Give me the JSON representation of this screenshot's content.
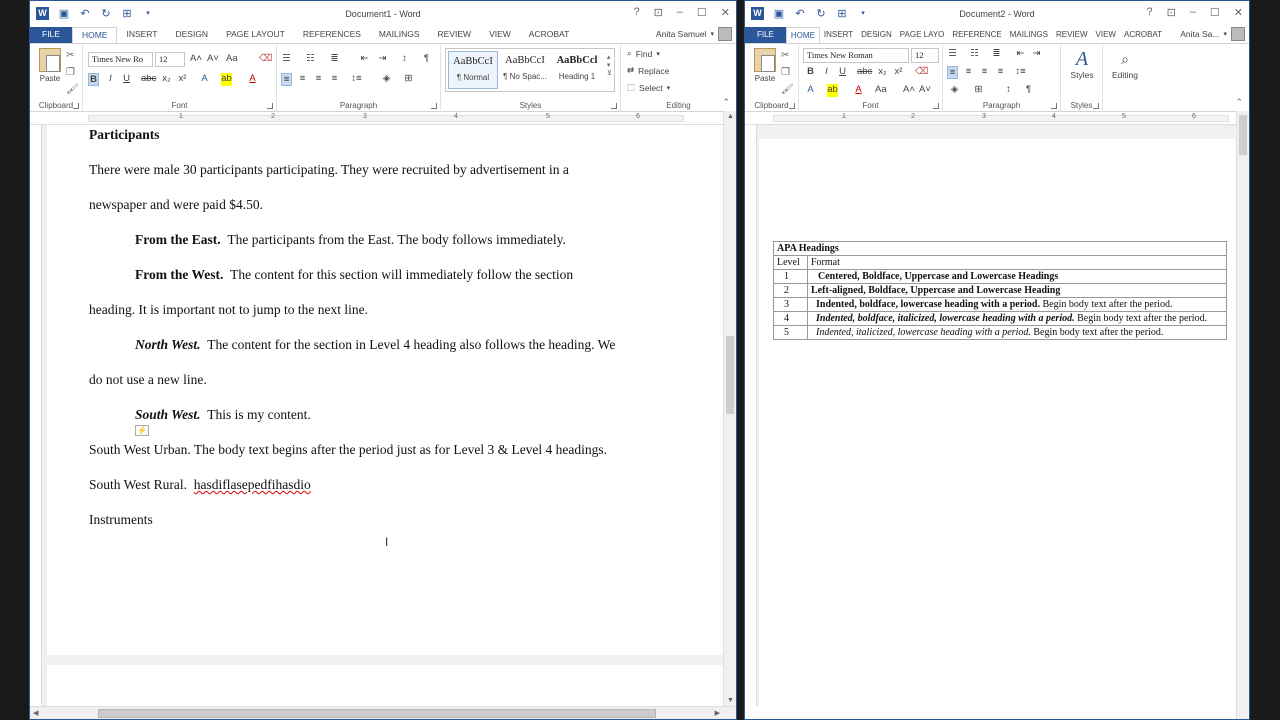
{
  "doc1": {
    "window_title": "Document1 - Word",
    "tabs": [
      "FILE",
      "HOME",
      "INSERT",
      "DESIGN",
      "PAGE LAYOUT",
      "REFERENCES",
      "MAILINGS",
      "REVIEW",
      "VIEW",
      "ACROBAT"
    ],
    "user": "Anita Samuel",
    "clipboard": {
      "paste": "Paste",
      "label": "Clipboard"
    },
    "font": {
      "name": "Times New Ro",
      "size": "12",
      "label": "Font",
      "aa": "Aa"
    },
    "paragraph": {
      "label": "Paragraph"
    },
    "styles": {
      "label": "Styles",
      "items": [
        {
          "preview": "AaBbCcI",
          "name": "¶ Normal"
        },
        {
          "preview": "AaBbCcI",
          "name": "¶ No Spac..."
        },
        {
          "preview": "AaBbCcl",
          "name": "Heading 1"
        }
      ]
    },
    "editing": {
      "label": "Editing",
      "find": "Find",
      "replace": "Replace",
      "select": "Select"
    },
    "ruler_numbers": [
      "1",
      "2",
      "3",
      "4",
      "5",
      "6"
    ],
    "content": {
      "participants_heading": "Participants",
      "p1_line1": "There were male 30 participants participating. They were recruited by advertisement in a",
      "p1_line2": "newspaper and were paid $4.50.",
      "east_heading": "From the East.",
      "east_body": "The participants from the East. The body follows immediately.",
      "west_heading": "From the West.",
      "west_body1": "The content for this section will immediately follow the section",
      "west_body2": "heading.  It is important not to jump to the next line.",
      "nw_heading": "North West.",
      "nw_body1": "The content for the section in Level 4 heading also follows the heading. We",
      "nw_body2": "do not use a new line.",
      "sw_heading": "South West.",
      "sw_body": "This is my content.",
      "swu_line": "South West Urban.  The body text begins after the period just as for Level 3 & Level 4 headings.",
      "swr_head": "South West Rural.",
      "swr_body": "hasdiflasepedfihasdio",
      "instruments": "Instruments"
    }
  },
  "doc2": {
    "window_title": "Document2 - Word",
    "tabs": [
      "FILE",
      "HOME",
      "INSERT",
      "DESIGN",
      "PAGE LAYO",
      "REFERENCE",
      "MAILINGS",
      "REVIEW",
      "VIEW",
      "ACROBAT"
    ],
    "user": "Anita Sa...",
    "clipboard": {
      "paste": "Paste",
      "label": "Clipboard"
    },
    "font": {
      "name": "Times New Roman",
      "size": "12",
      "label": "Font",
      "aa": "Aa"
    },
    "paragraph": {
      "label": "Paragraph"
    },
    "styles": {
      "label": "Styles",
      "button": "Styles"
    },
    "editing": {
      "label": "Editing"
    },
    "ruler_numbers": [
      "1",
      "2",
      "3",
      "4",
      "5",
      "6"
    ],
    "table": {
      "title": "APA Headings",
      "col_level": "Level",
      "col_format": "Format",
      "rows": [
        {
          "level": "1",
          "bold": "Centered, Boldface, Uppercase and Lowercase Headings",
          "rest": ""
        },
        {
          "level": "2",
          "bold": "Left-aligned, Boldface, Uppercase and Lowercase Heading",
          "rest": ""
        },
        {
          "level": "3",
          "bold": "Indented, boldface, lowercase heading with a period.",
          "rest": " Begin body text after the period."
        },
        {
          "level": "4",
          "bold": "Indented, boldface, italicized, lowercase heading with a period.",
          "rest": " Begin body text after the period."
        },
        {
          "level": "5",
          "bold": "Indented, italicized, lowercase heading with a period.",
          "rest": " Begin body text after the period."
        }
      ]
    }
  }
}
